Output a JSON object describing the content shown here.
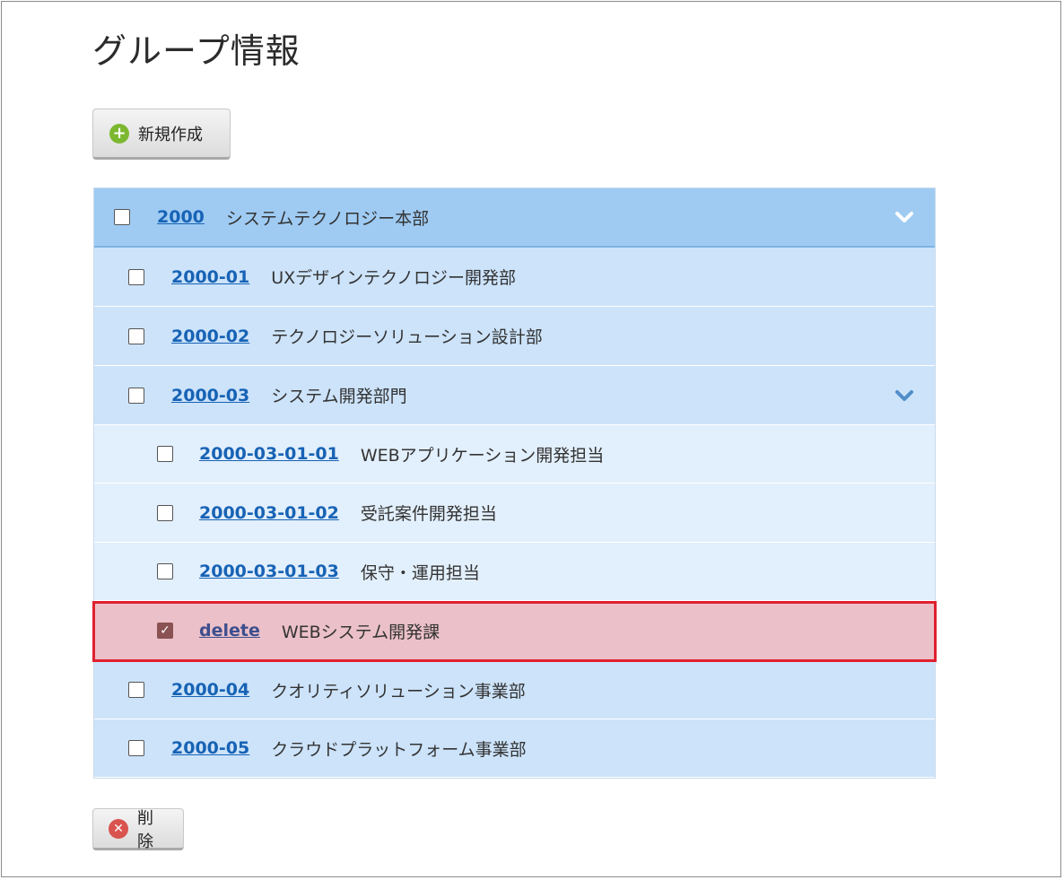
{
  "page": {
    "title": "グループ情報"
  },
  "toolbar": {
    "create_label": "新規作成",
    "delete_label": "削除"
  },
  "groups": [
    {
      "code": "2000",
      "name": "システムテクノロジー本部",
      "level": 0,
      "checked": false,
      "expandable": true
    },
    {
      "code": "2000-01",
      "name": "UXデザインテクノロジー開発部",
      "level": 1,
      "checked": false,
      "expandable": false
    },
    {
      "code": "2000-02",
      "name": "テクノロジーソリューション設計部",
      "level": 1,
      "checked": false,
      "expandable": false
    },
    {
      "code": "2000-03",
      "name": "システム開発部門",
      "level": 1,
      "checked": false,
      "expandable": true
    },
    {
      "code": "2000-03-01-01",
      "name": "WEBアプリケーション開発担当",
      "level": 2,
      "checked": false,
      "expandable": false
    },
    {
      "code": "2000-03-01-02",
      "name": "受託案件開発担当",
      "level": 2,
      "checked": false,
      "expandable": false
    },
    {
      "code": "2000-03-01-03",
      "name": "保守・運用担当",
      "level": 2,
      "checked": false,
      "expandable": false
    },
    {
      "code": "delete",
      "name": "WEBシステム開発課",
      "level": 2,
      "checked": true,
      "expandable": false
    },
    {
      "code": "2000-04",
      "name": "クオリティソリューション事業部",
      "level": 1,
      "checked": false,
      "expandable": false
    },
    {
      "code": "2000-05",
      "name": "クラウドプラットフォーム事業部",
      "level": 1,
      "checked": false,
      "expandable": false
    }
  ],
  "colors": {
    "link": "#1763b5",
    "selected_row": "#ebc0c9",
    "highlight_border": "#e0202e",
    "header_row": "#9fcbf3"
  }
}
